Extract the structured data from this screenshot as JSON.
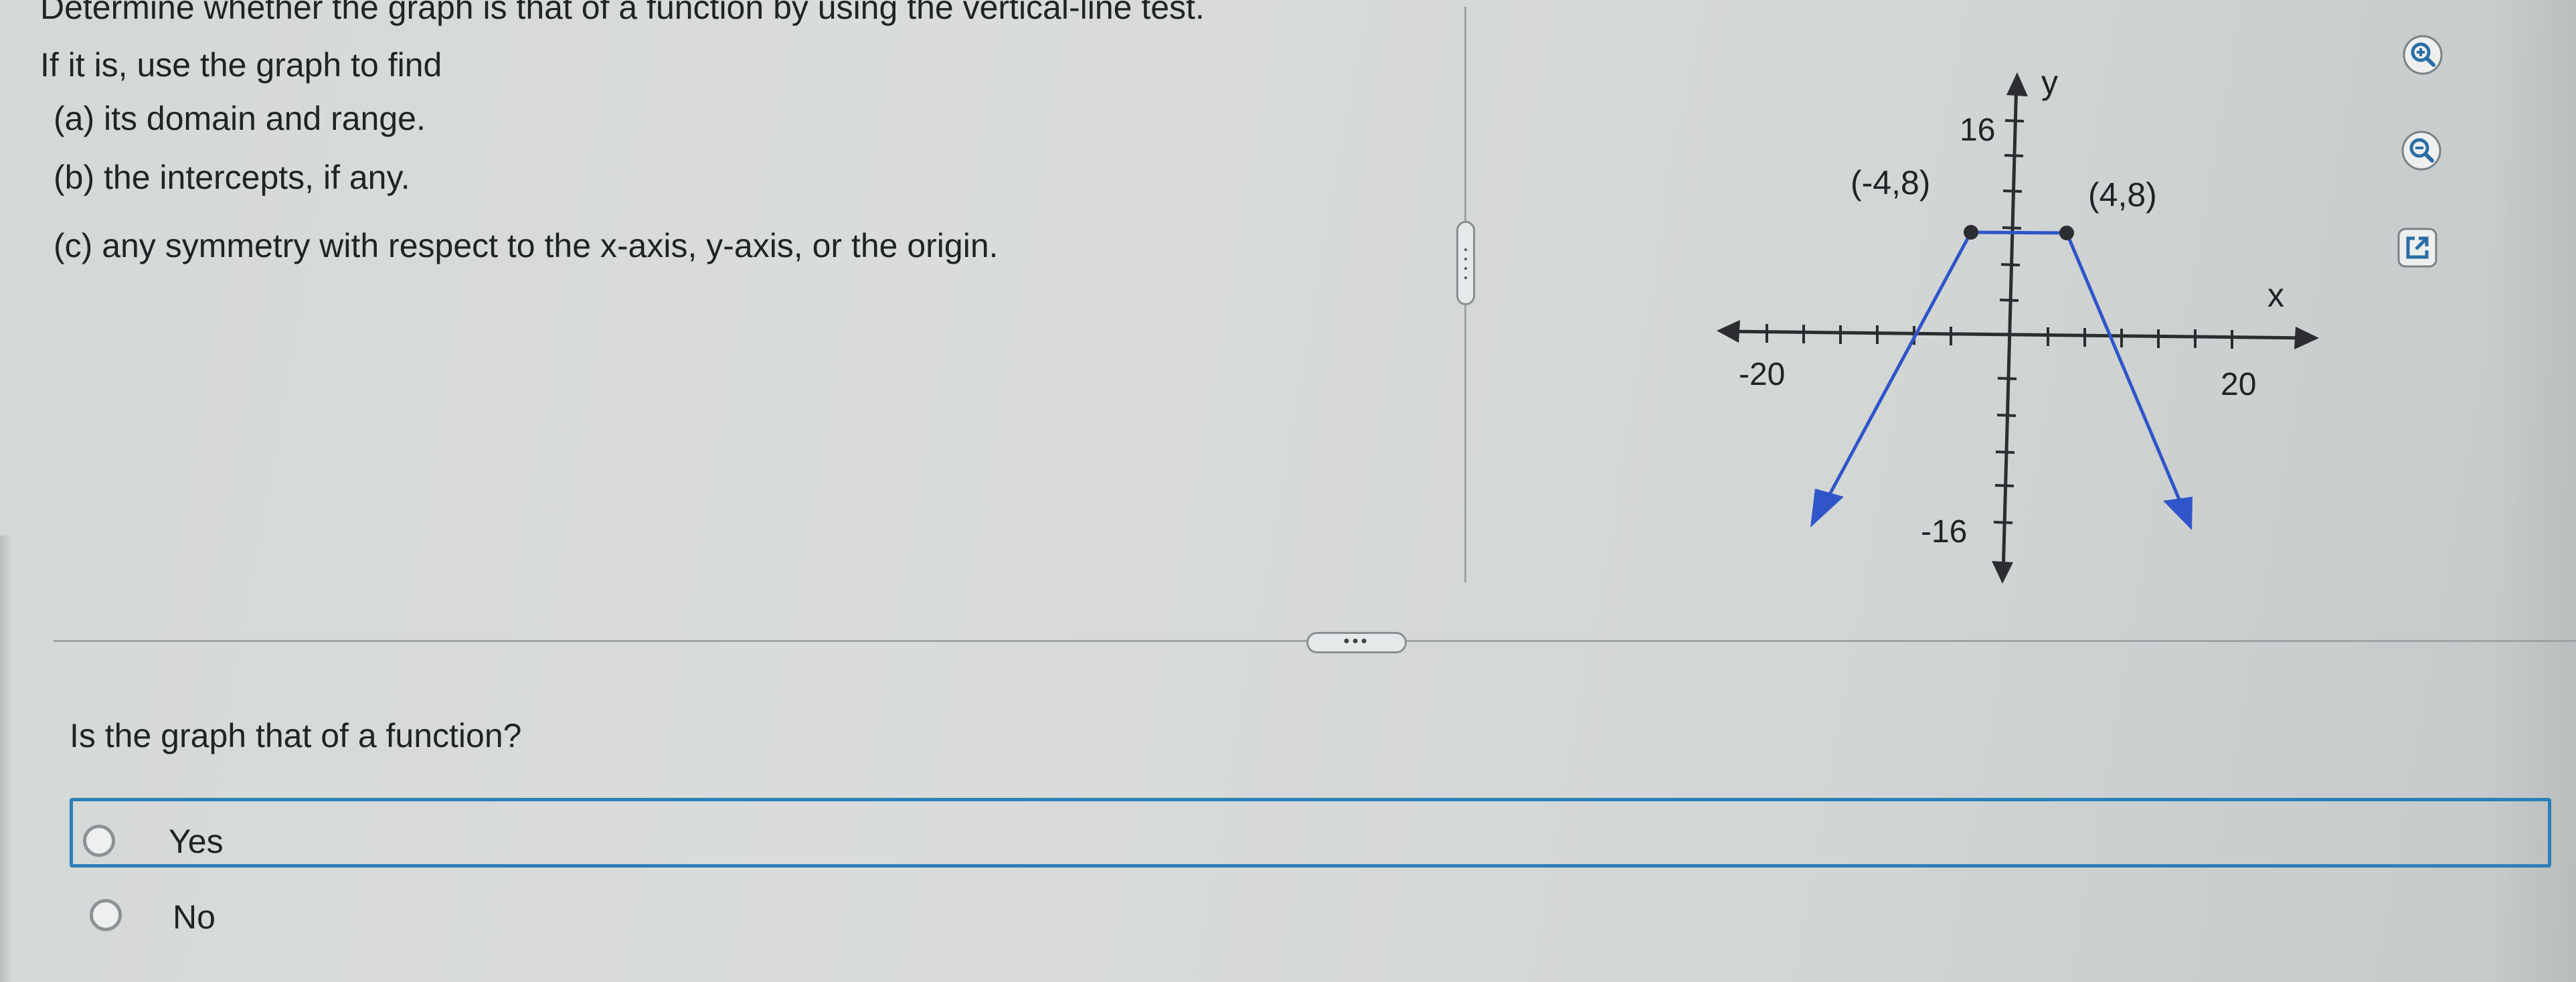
{
  "question": {
    "line1": "Determine whether the graph is that of a function by using the vertical-line test.",
    "line2": "If it is, use the graph to find",
    "part_a": "(a) its domain and range.",
    "part_b": "(b) the intercepts, if any.",
    "part_c": "(c) any symmetry with respect to the x-axis, y-axis, or the origin."
  },
  "graph": {
    "x_axis_label": "x",
    "y_axis_label": "y",
    "tick_x_min": "-20",
    "tick_x_max": "20",
    "tick_y_max": "16",
    "tick_y_min": "-16",
    "point_left": "(-4,8)",
    "point_right": "(4,8)",
    "line_color": "#2f55c8"
  },
  "subquestion": {
    "prompt": "Is the graph that of a function?",
    "options": [
      "Yes",
      "No"
    ],
    "selected_highlight": "Yes"
  },
  "toolbar": {
    "icons": [
      "zoom-in-icon",
      "zoom-out-icon",
      "open-new-window-icon"
    ]
  },
  "colors": {
    "accent": "#2a7fb8",
    "graph_line": "#2f55c8"
  }
}
